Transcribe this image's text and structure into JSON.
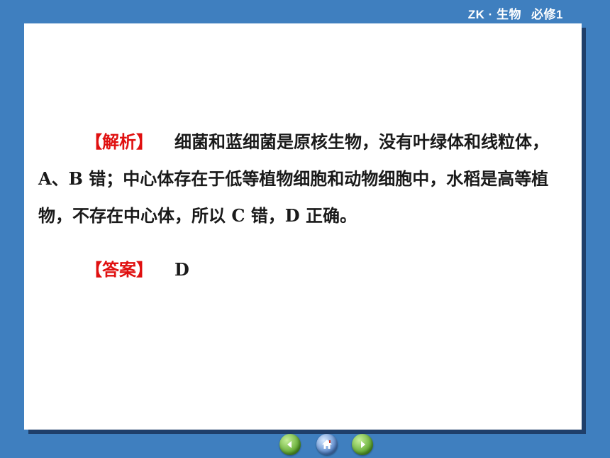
{
  "header": {
    "title_left": "ZK · 生物",
    "title_right": "必修1"
  },
  "analysis": {
    "tag": "【解析】",
    "text": "细菌和蓝细菌是原核生物，没有叶绿体和线粒体，A、B 错；中心体存在于低等植物细胞和动物细胞中，水稻是高等植物，不存在中心体，所以 C 错，D 正确。"
  },
  "answer": {
    "tag": "【答案】",
    "text": "D"
  },
  "nav": {
    "prev_icon": "arrow-left-icon",
    "home_icon": "home-icon",
    "next_icon": "arrow-right-icon",
    "colors": {
      "prev": "#5aa52a",
      "home": "#4d7fc7",
      "next": "#5aa52a"
    }
  },
  "theme": {
    "background": "#3f7fbf",
    "panel": "#ffffff",
    "tag_color": "#e01010"
  }
}
